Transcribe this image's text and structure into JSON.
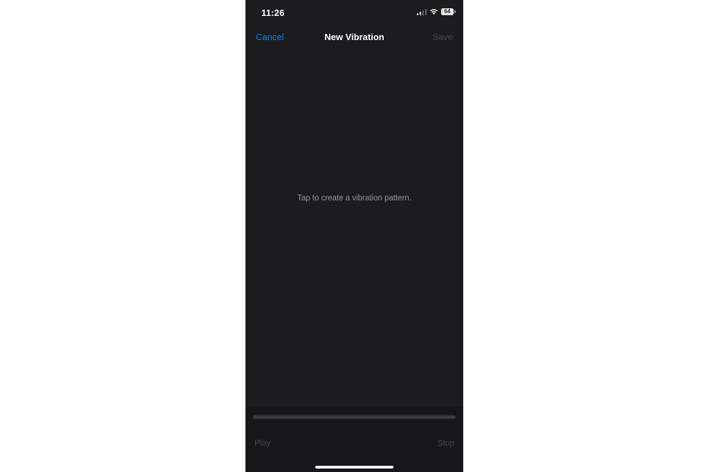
{
  "status_bar": {
    "time": "11:26",
    "battery_level": "64",
    "signal_bars_active": 2,
    "signal_bars_total": 4,
    "icons": [
      "cellular-signal-icon",
      "wifi-icon",
      "battery-icon"
    ]
  },
  "nav": {
    "cancel_label": "Cancel",
    "title": "New Vibration",
    "save_label": "Save"
  },
  "canvas": {
    "hint": "Tap to create a vibration pattern."
  },
  "controls": {
    "play_label": "Play",
    "stop_label": "Stop"
  },
  "colors": {
    "background": "#1c1c1e",
    "accent": "#0a84ff",
    "disabled_text": "#4a4a4d",
    "hint_text": "#98989d"
  }
}
